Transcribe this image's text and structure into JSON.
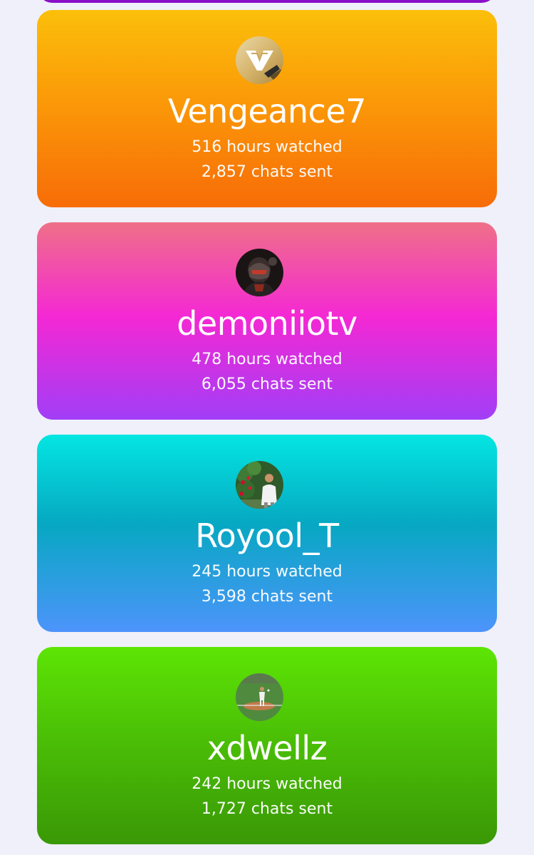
{
  "cards": [
    {
      "username": "Vengeance7",
      "hours": "516 hours watched",
      "chats": "2,857 chats sent",
      "gradient": [
        "#fbbf0a",
        "#f76c08"
      ]
    },
    {
      "username": "demoniiotv",
      "hours": "478 hours watched",
      "chats": "6,055 chats sent",
      "gradient": [
        "#ef7088",
        "#a13ef7"
      ]
    },
    {
      "username": "Royool_T",
      "hours": "245 hours watched",
      "chats": "3,598 chats sent",
      "gradient": [
        "#04e6e2",
        "#4d94fb"
      ]
    },
    {
      "username": "xdwellz",
      "hours": "242 hours watched",
      "chats": "1,727 chats sent",
      "gradient": [
        "#5de505",
        "#3a9806"
      ]
    }
  ],
  "colors": {
    "page_background": "#eff0fa",
    "text": "#ffffff",
    "top_card": "#8a0fc9"
  }
}
